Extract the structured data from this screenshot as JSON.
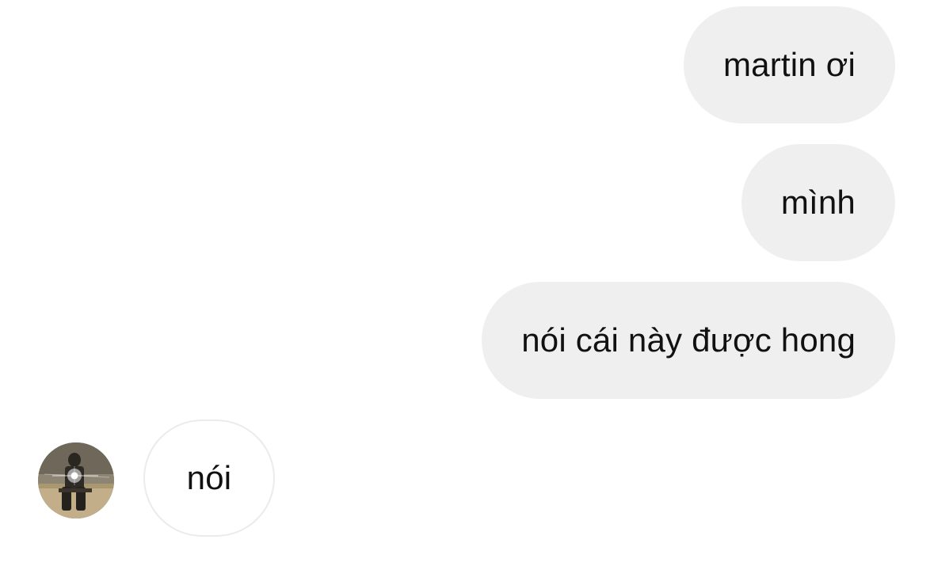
{
  "conversation": {
    "messages": [
      {
        "sender": "me",
        "text": "martin ơi"
      },
      {
        "sender": "me",
        "text": "mình"
      },
      {
        "sender": "me",
        "text": "nói cái này được hong"
      },
      {
        "sender": "other",
        "text": "nói"
      }
    ]
  },
  "colors": {
    "outgoing_bubble": "#efefef",
    "incoming_bubble": "#ffffff",
    "incoming_border": "#ebebeb",
    "text": "#111111"
  },
  "icons": {
    "avatar": "profile-photo"
  }
}
